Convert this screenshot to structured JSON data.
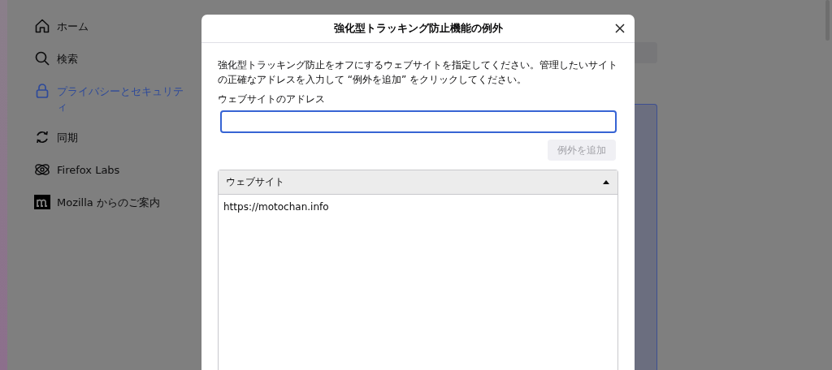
{
  "sidebar": {
    "items": [
      {
        "kind": "home",
        "label": "ホーム",
        "selected": false
      },
      {
        "kind": "search",
        "label": "検索",
        "selected": false
      },
      {
        "kind": "lock",
        "label": "プライバシーとセキュリティ",
        "selected": true
      },
      {
        "kind": "sync",
        "label": "同期",
        "selected": false
      },
      {
        "kind": "labs",
        "label": "Firefox Labs",
        "selected": false
      },
      {
        "kind": "mozilla",
        "label": "Mozilla からのご案内",
        "selected": false
      }
    ]
  },
  "dialog": {
    "title": "強化型トラッキング防止機能の例外",
    "description": "強化型トラッキング防止をオフにするウェブサイトを指定してください。管理したいサイトの正確なアドレスを入力して “例外を追加” をクリックしてください。",
    "address_label": "ウェブサイトのアドレス",
    "add_button": {
      "label": "例外を追加",
      "disabled": true
    },
    "table": {
      "columns": [
        {
          "label": "ウェブサイト",
          "sorted_ascending": true
        }
      ],
      "rows": [
        {
          "website": "https://motochan.info"
        }
      ]
    }
  }
}
